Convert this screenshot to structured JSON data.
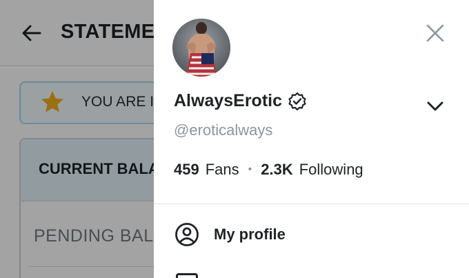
{
  "background": {
    "header": {
      "title": "STATEMENTS"
    },
    "notice": {
      "text": "YOU ARE IN"
    },
    "balance": {
      "current_label": "CURRENT BALANCE",
      "pending_label": "PENDING BALANCE"
    }
  },
  "drawer": {
    "user": {
      "name": "AlwaysErotic",
      "handle": "@eroticalways"
    },
    "stats": {
      "fans_count": "459",
      "fans_label": "Fans",
      "separator": "•",
      "following_count": "2.3K",
      "following_label": "Following"
    },
    "menu": [
      {
        "label": "My profile",
        "icon": "profile-icon"
      }
    ]
  },
  "colors": {
    "accent_light": "#a8d6ef",
    "star": "#f2b01e",
    "text_primary": "#1f2326",
    "text_muted": "#8a96a0"
  }
}
